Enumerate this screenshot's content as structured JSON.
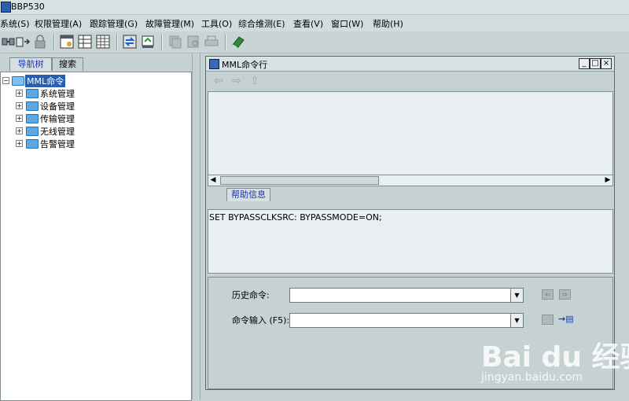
{
  "app": {
    "title": "BBP530"
  },
  "menu": [
    "系统(S)",
    "权限管理(A)",
    "跟踪管理(G)",
    "故障管理(M)",
    "工具(O)",
    "综合维测(E)",
    "查看(V)",
    "窗口(W)",
    "帮助(H)"
  ],
  "toolbar": {
    "icons": [
      "connect-icon",
      "disconnect-icon",
      "lock-icon",
      "calendar-icon",
      "table-icon",
      "grid-icon",
      "sync-icon",
      "export-icon",
      "copy-icon",
      "preview-icon",
      "print-icon",
      "book-icon"
    ]
  },
  "left_tabs": {
    "nav": "导航树",
    "search": "搜索"
  },
  "tree": {
    "root": "MML命令",
    "children": [
      "系统管理",
      "设备管理",
      "传输管理",
      "无线管理",
      "告警管理"
    ]
  },
  "mml_window": {
    "title": "MML命令行",
    "help_tab": "帮助信息",
    "help_text": "SET BYPASSCLKSRC: BYPASSMODE=ON;",
    "history_label": "历史命令:",
    "input_label": "命令输入 (F5):",
    "history_value": "",
    "input_value": ""
  },
  "watermark": {
    "brand": "Bai du 经验",
    "url": "jingyan.baidu.com"
  },
  "colors": {
    "background": "#c5d1d2",
    "tab_active_text": "#2033a8",
    "selection": "#2a5fb0"
  }
}
